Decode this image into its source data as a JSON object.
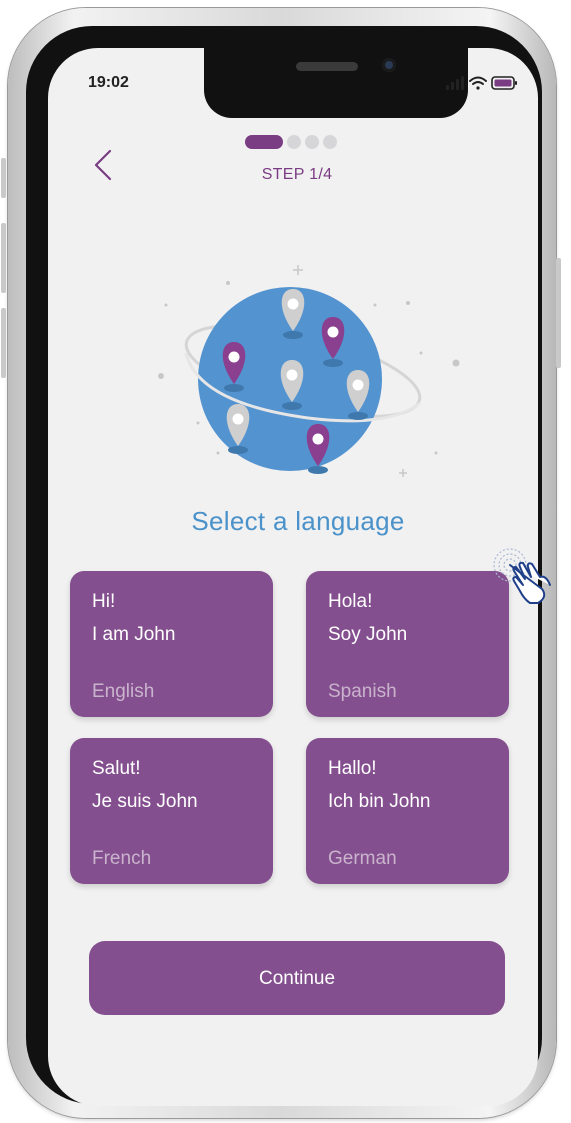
{
  "status": {
    "time": "19:02"
  },
  "progress": {
    "step_label": "STEP 1/4",
    "current_step": 1,
    "total_steps": 4
  },
  "title": "Select a language",
  "languages": [
    {
      "greeting": "Hi!",
      "intro": "I am John",
      "language": "English"
    },
    {
      "greeting": "Hola!",
      "intro": "Soy John",
      "language": "Spanish"
    },
    {
      "greeting": "Salut!",
      "intro": "Je suis John",
      "language": "French"
    },
    {
      "greeting": "Hallo!",
      "intro": "Ich bin John",
      "language": "German"
    }
  ],
  "continue_label": "Continue",
  "colors": {
    "accent": "#844f8e",
    "progress": "#7a3c82",
    "title": "#4a92c9",
    "background": "#f1f1f2"
  },
  "icons": [
    "back-icon",
    "signal-icon",
    "wifi-icon",
    "battery-icon",
    "globe-icon",
    "map-pin-icon",
    "hand-tap-icon"
  ]
}
